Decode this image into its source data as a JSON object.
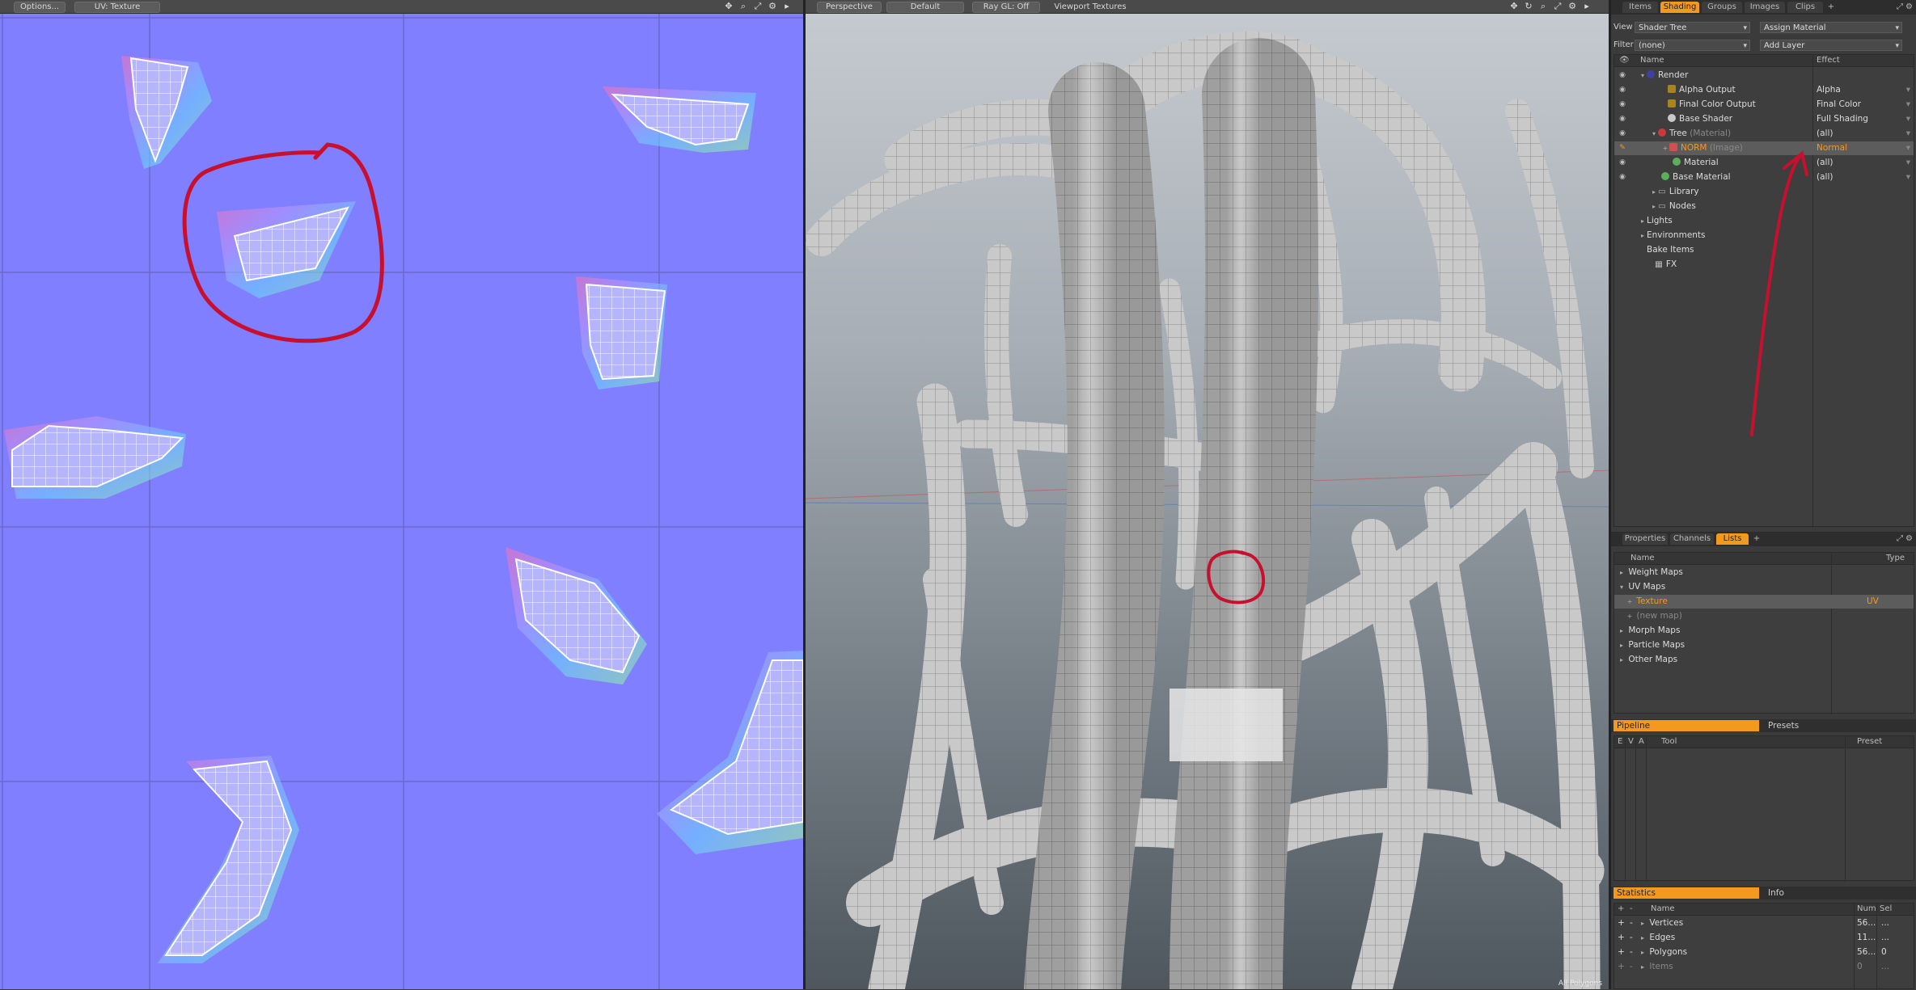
{
  "uv_view": {
    "options_label": "Options...",
    "map_label": "UV: Texture",
    "bg_color": "#7f7fff"
  },
  "viewport": {
    "perspective_label": "Perspective",
    "default_label": "Default",
    "raygl_label": "Ray GL: Off",
    "textures_label": "Viewport Textures",
    "status_text": "All Polygons"
  },
  "right_panel": {
    "top_tabs": [
      "Items",
      "Shading",
      "Groups",
      "Images",
      "Clips"
    ],
    "top_active_tab": "Shading",
    "plus_tab": "+",
    "view_label": "View",
    "view_value": "Shader Tree",
    "assign_material": "Assign Material",
    "filter_label": "Filter",
    "filter_value": "(none)",
    "add_layer": "Add Layer",
    "shader_header": {
      "name": "Name",
      "effect": "Effect"
    },
    "shader_rows": [
      {
        "label": "Render",
        "sub": "",
        "effect": ""
      },
      {
        "label": "Alpha Output",
        "sub": "",
        "effect": "Alpha"
      },
      {
        "label": "Final Color Output",
        "sub": "",
        "effect": "Final Color"
      },
      {
        "label": "Base Shader",
        "sub": "",
        "effect": "Full Shading"
      },
      {
        "label": "Tree",
        "sub": "(Material)",
        "effect": "(all)"
      },
      {
        "label": "NORM",
        "sub": "(Image)",
        "effect": "Normal"
      },
      {
        "label": "Material",
        "sub": "",
        "effect": "(all)"
      },
      {
        "label": "Base Material",
        "sub": "",
        "effect": "(all)"
      },
      {
        "label": "Library",
        "sub": "",
        "effect": ""
      },
      {
        "label": "Nodes",
        "sub": "",
        "effect": ""
      },
      {
        "label": "Lights",
        "sub": "",
        "effect": ""
      },
      {
        "label": "Environments",
        "sub": "",
        "effect": ""
      },
      {
        "label": "Bake Items",
        "sub": "",
        "effect": ""
      },
      {
        "label": "FX",
        "sub": "",
        "effect": ""
      }
    ],
    "mid_tabs": [
      "Properties",
      "Channels",
      "Lists"
    ],
    "mid_active_tab": "Lists",
    "lists_header": {
      "name": "Name",
      "type": "Type"
    },
    "lists_rows": [
      {
        "label": "Weight Maps",
        "type": ""
      },
      {
        "label": "UV Maps",
        "type": ""
      },
      {
        "label": "Texture",
        "type": "UV"
      },
      {
        "label": "(new map)",
        "type": ""
      },
      {
        "label": "Morph Maps",
        "type": ""
      },
      {
        "label": "Particle Maps",
        "type": ""
      },
      {
        "label": "Other Maps",
        "type": ""
      }
    ],
    "pipeline_tab": "Pipeline",
    "presets_tab": "Presets",
    "pipeline_header": {
      "e": "E",
      "v": "V",
      "a": "A",
      "tool": "Tool",
      "preset": "Preset"
    },
    "statistics_tab": "Statistics",
    "info_tab": "Info",
    "stats_header": {
      "name": "Name",
      "num": "Num",
      "sel": "Sel"
    },
    "stats_rows": [
      {
        "label": "Vertices",
        "num": "56...",
        "sel": "..."
      },
      {
        "label": "Edges",
        "num": "11...",
        "sel": "..."
      },
      {
        "label": "Polygons",
        "num": "56...",
        "sel": "0"
      },
      {
        "label": "Items",
        "num": "0",
        "sel": "..."
      }
    ],
    "accent_color": "#f39a1e"
  }
}
